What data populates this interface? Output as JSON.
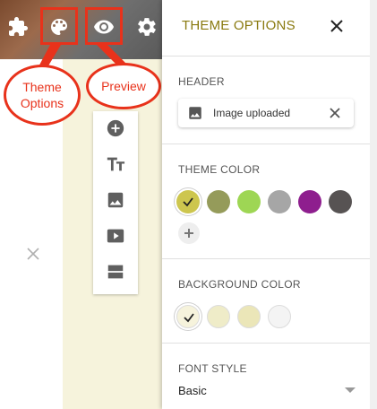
{
  "left": {
    "top_icons": [
      "puzzle-icon",
      "palette-icon",
      "eye-icon",
      "gear-icon"
    ],
    "callouts": {
      "theme": "Theme Options",
      "preview": "Preview"
    },
    "toolbar": [
      "add-circle-icon",
      "text-size-icon",
      "image-icon",
      "video-icon",
      "layout-icon"
    ],
    "colors": {
      "editor_bg": "#f6f3dc",
      "annotation": "#e8321b"
    }
  },
  "panel": {
    "title": "THEME OPTIONS",
    "header": {
      "label": "HEADER",
      "value": "Image uploaded"
    },
    "theme_color": {
      "label": "THEME COLOR",
      "swatches": [
        "#cdc64e",
        "#959b5a",
        "#9ed654",
        "#a6a6a6",
        "#8e1e8e",
        "#575353"
      ],
      "selected": 0
    },
    "background_color": {
      "label": "BACKGROUND COLOR",
      "swatches": [
        "#f6f3dc",
        "#efecc8",
        "#ebe6b8",
        "#f4f4f4"
      ],
      "selected": 0
    },
    "font_style": {
      "label": "FONT STYLE",
      "value": "Basic"
    },
    "colors": {
      "title": "#8a7a10"
    }
  }
}
